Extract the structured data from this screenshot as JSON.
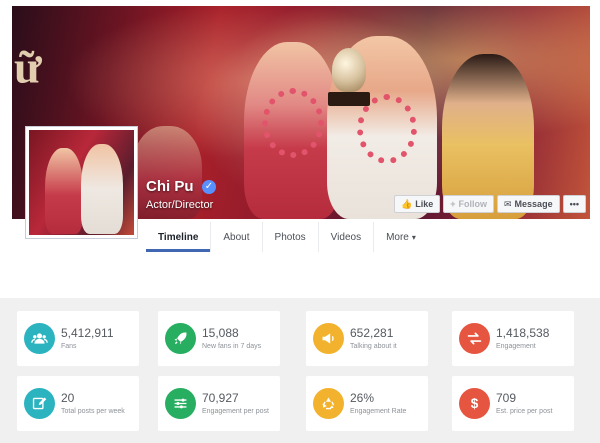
{
  "page": {
    "name": "Chi Pu",
    "category": "Actor/Director",
    "cover_text": "ữ"
  },
  "actions": [
    {
      "label": "Like",
      "icon": "thumbs-up-icon",
      "disabled": false
    },
    {
      "label": "Follow",
      "icon": "plus-icon",
      "disabled": true
    },
    {
      "label": "Message",
      "icon": "message-icon",
      "disabled": false
    },
    {
      "label": "•••",
      "icon": "more-dots-icon",
      "disabled": false
    }
  ],
  "tabs": [
    {
      "label": "Timeline",
      "active": true
    },
    {
      "label": "About",
      "active": false
    },
    {
      "label": "Photos",
      "active": false
    },
    {
      "label": "Videos",
      "active": false
    },
    {
      "label": "More",
      "active": false,
      "caret": "▾"
    }
  ],
  "stats": [
    {
      "value": "5,412,911",
      "label": "Fans",
      "icon": "people-icon",
      "color": "#2bb3c0"
    },
    {
      "value": "15,088",
      "label": "New fans in 7 days",
      "icon": "rocket-icon",
      "color": "#27ae60"
    },
    {
      "value": "652,281",
      "label": "Talking about it",
      "icon": "megaphone-icon",
      "color": "#f3b22d"
    },
    {
      "value": "1,418,538",
      "label": "Engagement",
      "icon": "swap-arrows-icon",
      "color": "#e6553f"
    },
    {
      "value": "20",
      "label": "Total posts per week",
      "icon": "edit-icon",
      "color": "#2bb3c0"
    },
    {
      "value": "70,927",
      "label": "Engagement per post",
      "icon": "sliders-icon",
      "color": "#27ae60"
    },
    {
      "value": "26%",
      "label": "Engagement Rate",
      "icon": "recycle-icon",
      "color": "#f3b22d"
    },
    {
      "value": "709",
      "label": "Est. price per post",
      "icon": "dollar-icon",
      "color": "#e6553f"
    }
  ]
}
